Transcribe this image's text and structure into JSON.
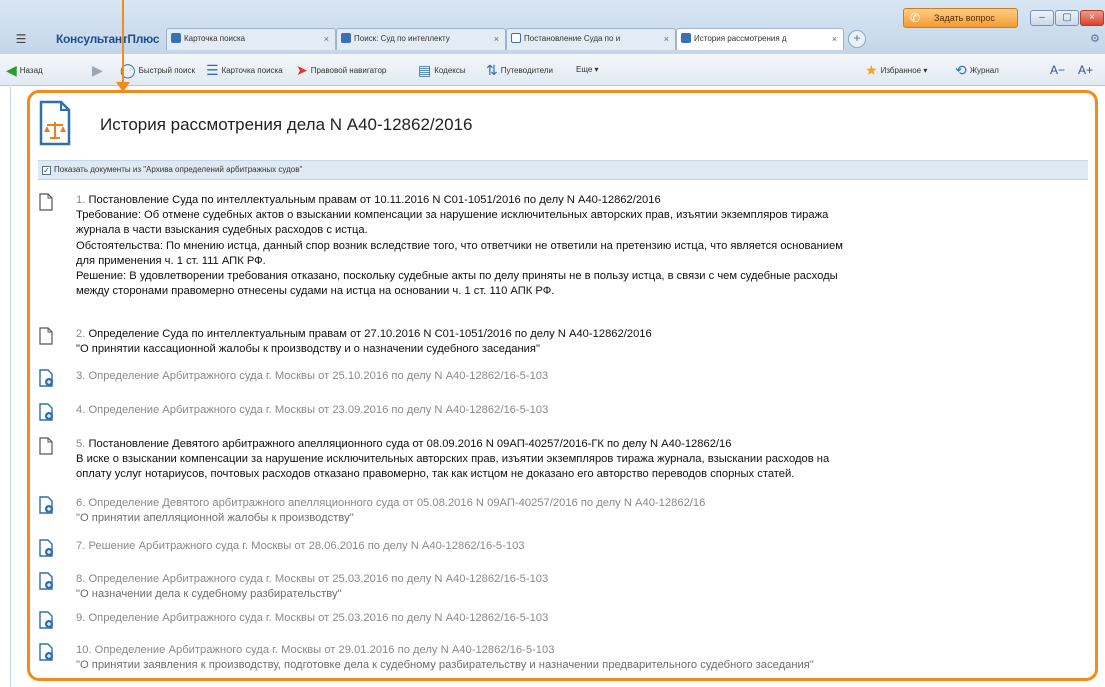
{
  "app": {
    "brand": "КонсультантПлюс",
    "menu_glyph": "☰",
    "ask_button": "Задать вопрос"
  },
  "tabs": [
    {
      "label": "Карточка поиска",
      "close": "×"
    },
    {
      "label": "Поиск: Суд по интеллекту",
      "close": "×"
    },
    {
      "label": "Постановление Суда по и",
      "close": "×"
    },
    {
      "label": "История рассмотрения д",
      "close": "×"
    }
  ],
  "toolbar": {
    "back": "Назад",
    "quick_search": "Быстрый поиск",
    "search_card": "Карточка поиска",
    "legal_navigator": "Правовой навигатор",
    "codes": "Кодексы",
    "guides": "Путеводители",
    "more": "Еще ▾",
    "favorites": "Избранное ▾",
    "journal": "Журнал",
    "font_smaller": "A−",
    "font_larger": "A+"
  },
  "page": {
    "title": "История рассмотрения дела N А40-12862/2016",
    "archive_checkbox_checked": true,
    "archive_label": "Показать документы из \"Архива определений арбитражных судов\""
  },
  "documents": [
    {
      "number": "1.",
      "title": "Постановление Суда по интеллектуальным правам от 10.11.2016 N С01-1051/2016 по делу N А40-12862/2016",
      "lines": [
        "Требование: Об отмене судебных актов о взыскании компенсации за нарушение исключительных авторских прав, изъятии экземпляров тиража",
        "журнала в части взыскания судебных расходов с истца.",
        "Обстоятельства: По мнению истца, данный спор возник вследствие того, что ответчики не ответили на претензию истца, что является основанием",
        "для применения ч. 1 ст. 111 АПК РФ.",
        "Решение: В удовлетворении требования отказано, поскольку судебные акты по делу приняты не в пользу истца, в связи с чем судебные расходы",
        "между сторонами правомерно отнесены судами на истца на основании ч. 1 ст. 110 АПК РФ."
      ],
      "style": "strong",
      "icon": "document-icon"
    },
    {
      "number": "2.",
      "title": "Определение Суда по интеллектуальным правам от 27.10.2016 N С01-1051/2016 по делу N А40-12862/2016",
      "lines": [
        "\"О принятии кассационной жалобы к производству и о назначении судебного заседания\""
      ],
      "style": "strong",
      "icon": "document-icon"
    },
    {
      "number": "3.",
      "title": "Определение Арбитражного суда г. Москвы от 25.10.2016 по делу N А40-12862/16-5-103",
      "lines": [],
      "style": "muted",
      "icon": "archive-document-icon"
    },
    {
      "number": "4.",
      "title": "Определение Арбитражного суда г. Москвы от 23.09.2016 по делу N А40-12862/16-5-103",
      "lines": [],
      "style": "muted",
      "icon": "archive-document-icon"
    },
    {
      "number": "5.",
      "title": "Постановление Девятого арбитражного апелляционного суда от 08.09.2016 N 09АП-40257/2016-ГК по делу N А40-12862/16",
      "lines": [
        "В иске о взыскании компенсации за нарушение исключительных авторских прав, изъятии экземпляров тиража журнала, взыскании расходов на",
        "оплату услуг нотариусов, почтовых расходов отказано правомерно, так как истцом не доказано его авторство переводов спорных статей."
      ],
      "style": "strong",
      "icon": "document-icon"
    },
    {
      "number": "6.",
      "title": "Определение Девятого арбитражного апелляционного суда от 05.08.2016 N 09АП-40257/2016 по делу N А40-12862/16",
      "lines": [
        "\"О принятии апелляционной жалобы к производству\""
      ],
      "style": "muted",
      "icon": "archive-document-icon"
    },
    {
      "number": "7.",
      "title": "Решение Арбитражного суда г. Москвы от 28.06.2016 по делу N А40-12862/16-5-103",
      "lines": [],
      "style": "muted",
      "icon": "archive-document-icon"
    },
    {
      "number": "8.",
      "title": "Определение Арбитражного суда г. Москвы от 25.03.2016 по делу N А40-12862/16-5-103",
      "lines": [
        "\"О назначении дела к судебному разбирательству\""
      ],
      "style": "muted",
      "icon": "archive-document-icon"
    },
    {
      "number": "9.",
      "title": "Определение Арбитражного суда г. Москвы от 25.03.2016 по делу N А40-12862/16-5-103",
      "lines": [],
      "style": "muted",
      "icon": "archive-document-icon"
    },
    {
      "number": "10.",
      "title": "Определение Арбитражного суда г. Москвы от 29.01.2016 по делу N А40-12862/16-5-103",
      "lines": [
        "\"О принятии заявления к производству, подготовке дела к судебному разбирательству и назначении предварительного судебного заседания\""
      ],
      "style": "muted",
      "icon": "archive-document-icon"
    }
  ],
  "colors": {
    "highlight": "#f28a1e",
    "brand": "#1f4e8f",
    "archive_bar": "#dfe9f4",
    "muted_text": "#8a8a8a"
  }
}
